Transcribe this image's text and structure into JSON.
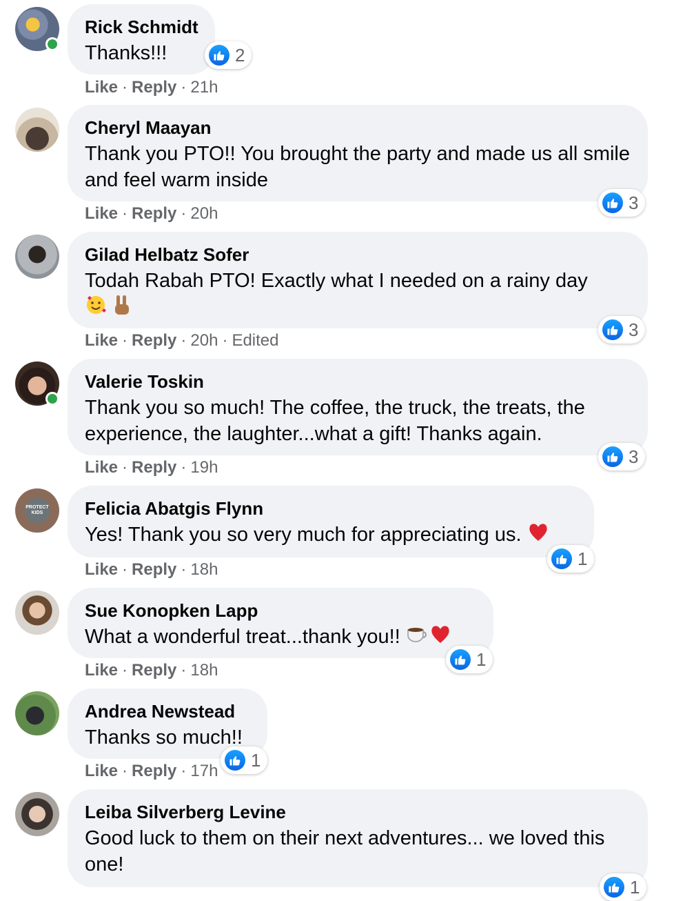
{
  "comments": [
    {
      "author": "Rick Schmidt",
      "text": "Thanks!!!",
      "meta": {
        "like": "Like",
        "reply": "Reply",
        "time": "21h",
        "edited": ""
      },
      "reactions": {
        "icon": "like-icon",
        "count": "2"
      },
      "online": true
    },
    {
      "author": "Cheryl Maayan",
      "text": "Thank you PTO!! You brought the party and made us all smile and feel warm inside",
      "meta": {
        "like": "Like",
        "reply": "Reply",
        "time": "20h",
        "edited": ""
      },
      "reactions": {
        "icon": "like-icon",
        "count": "3"
      },
      "online": false
    },
    {
      "author": "Gilad Helbatz Sofer",
      "text": "Todah Rabah PTO! Exactly what I needed on a rainy day",
      "emoji": [
        "smiling-face-with-hearts-emoji",
        "victory-hand-emoji"
      ],
      "meta": {
        "like": "Like",
        "reply": "Reply",
        "time": "20h",
        "edited": "Edited"
      },
      "reactions": {
        "icon": "like-icon",
        "count": "3"
      },
      "online": false
    },
    {
      "author": "Valerie Toskin",
      "text": "Thank you so much! The coffee, the truck, the treats, the experience, the laughter...what a gift! Thanks again.",
      "meta": {
        "like": "Like",
        "reply": "Reply",
        "time": "19h",
        "edited": ""
      },
      "reactions": {
        "icon": "like-icon",
        "count": "3"
      },
      "online": true
    },
    {
      "author": "Felicia Abatgis Flynn",
      "text": "Yes! Thank you so very much for appreciating us.",
      "emoji": [
        "red-heart-emoji"
      ],
      "meta": {
        "like": "Like",
        "reply": "Reply",
        "time": "18h",
        "edited": ""
      },
      "reactions": {
        "icon": "like-icon",
        "count": "1"
      },
      "online": false,
      "avatar_text": "PROTECT KIDS"
    },
    {
      "author": "Sue Konopken Lapp",
      "text": "What a wonderful treat...thank you!!",
      "emoji": [
        "coffee-emoji",
        "red-heart-emoji"
      ],
      "meta": {
        "like": "Like",
        "reply": "Reply",
        "time": "18h",
        "edited": ""
      },
      "reactions": {
        "icon": "like-icon",
        "count": "1"
      },
      "online": false
    },
    {
      "author": "Andrea Newstead",
      "text": "Thanks so much!!",
      "meta": {
        "like": "Like",
        "reply": "Reply",
        "time": "17h",
        "edited": ""
      },
      "reactions": {
        "icon": "like-icon",
        "count": "1"
      },
      "online": false
    },
    {
      "author": "Leiba Silverberg Levine",
      "text": "Good luck to them on their next adventures... we loved this one!",
      "meta": {
        "like": "",
        "reply": "",
        "time": "",
        "edited": ""
      },
      "reactions": {
        "icon": "like-icon",
        "count": "1"
      },
      "online": false
    }
  ],
  "colors": {
    "bubble": "#f0f2f5",
    "like_blue": "#1877f2",
    "online": "#31a24c",
    "meta_text": "#65676b"
  }
}
